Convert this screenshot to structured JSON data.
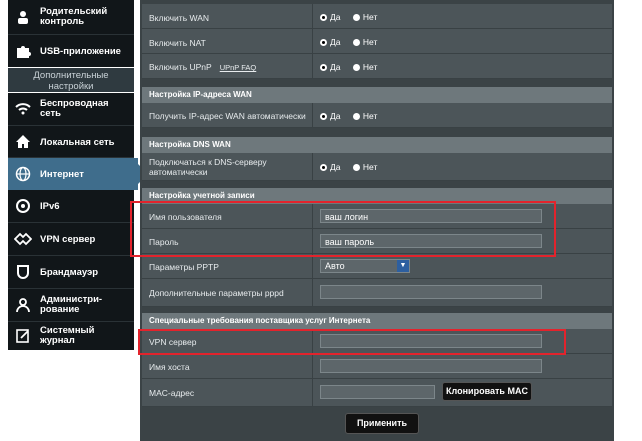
{
  "sidebar": {
    "items_top": [
      {
        "label": "Родительский\nконтроль",
        "icon": "parental-icon"
      },
      {
        "label": "USB-приложение",
        "icon": "puzzle-icon"
      }
    ],
    "advanced_header": "Дополнительные\nнастройки",
    "items": [
      {
        "label": "Беспроводная\nсеть",
        "icon": "wifi-icon"
      },
      {
        "label": "Локальная сеть",
        "icon": "home-icon"
      },
      {
        "label": "Интернет",
        "icon": "globe-icon",
        "active": true
      },
      {
        "label": "IPv6",
        "icon": "ipv6-icon"
      },
      {
        "label": "VPN сервер",
        "icon": "vpn-icon"
      },
      {
        "label": "Брандмауэр",
        "icon": "shield-icon"
      },
      {
        "label": "Администри-\nрование",
        "icon": "admin-icon"
      },
      {
        "label": "Системный\nжурнал",
        "icon": "log-icon"
      }
    ]
  },
  "wan": {
    "enable_wan": "Включить WAN",
    "enable_nat": "Включить NAT",
    "enable_upnp": "Включить UPnP",
    "upnp_faq": "UPnP FAQ",
    "yes": "Да",
    "no": "Нет"
  },
  "ip_section": {
    "title": "Настройка IP-адреса WAN",
    "auto_ip": "Получить IP-адрес WAN автоматически"
  },
  "dns_section": {
    "title": "Настройка DNS WAN",
    "auto_dns": "Подключаться к DNS-серверу\nавтоматически"
  },
  "account_section": {
    "title": "Настройка учетной записи",
    "username_label": "Имя пользователя",
    "username_value": "ваш логин",
    "password_label": "Пароль",
    "password_value": "ваш пароль",
    "pptp_label": "Параметры PPTP",
    "pptp_value": "Авто",
    "pppd_label": "Дополнительные параметры pppd",
    "pppd_value": ""
  },
  "isp_section": {
    "title": "Специальные требования поставщика услуг Интернета",
    "vpn_label": "VPN сервер",
    "vpn_value": "",
    "host_label": "Имя хоста",
    "host_value": "",
    "mac_label": "MAC-адрес",
    "mac_value": "",
    "clone_mac": "Клонировать MAC"
  },
  "apply_label": "Применить",
  "colors": {
    "highlight": "#e3232c",
    "active": "#3f6d8c",
    "panel": "#4c5559"
  }
}
